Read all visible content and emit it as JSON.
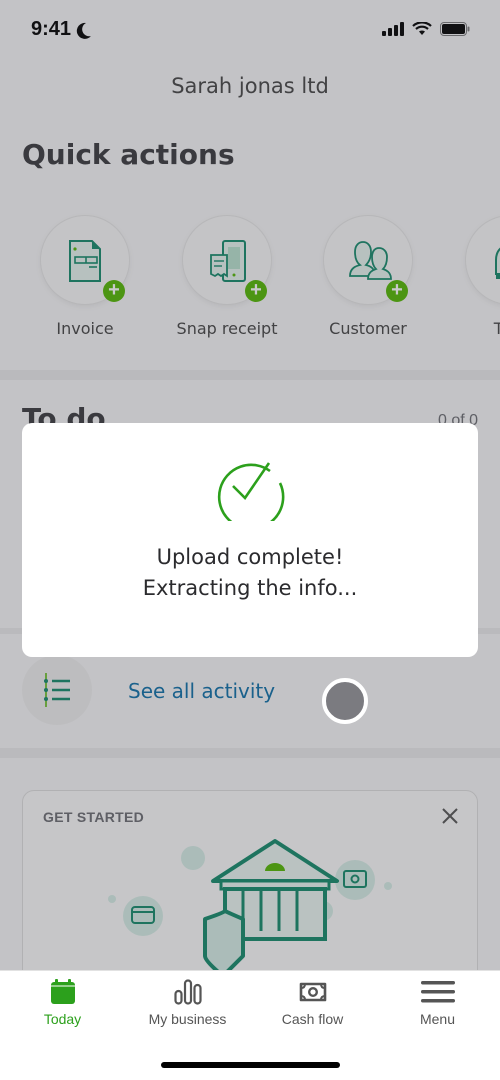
{
  "status_bar": {
    "time": "9:41",
    "focus_icon": "moon-icon",
    "icons": [
      "cellular-signal-icon",
      "wifi-icon",
      "battery-icon"
    ]
  },
  "header": {
    "company_name": "Sarah jonas ltd"
  },
  "quick_actions": {
    "title": "Quick actions",
    "items": [
      {
        "label": "Invoice",
        "icon": "invoice-icon"
      },
      {
        "label": "Snap receipt",
        "icon": "snap-receipt-icon"
      },
      {
        "label": "Customer",
        "icon": "customer-icon"
      },
      {
        "label": "Trac",
        "icon": "track-mileage-icon"
      }
    ]
  },
  "todo": {
    "title": "To do",
    "count": "0 of 0"
  },
  "activity": {
    "link_label": "See all activity",
    "icon": "activity-list-icon"
  },
  "get_started": {
    "label": "GET STARTED",
    "close_icon": "close-icon",
    "illustration": "bank-shield-illustration"
  },
  "modal": {
    "icon": "check-circle-icon",
    "line1": "Upload complete!",
    "line2": "Extracting the info..."
  },
  "tab_bar": {
    "tabs": [
      {
        "label": "Today",
        "icon": "calendar-icon",
        "active": true
      },
      {
        "label": "My business",
        "icon": "bar-chart-icon",
        "active": false
      },
      {
        "label": "Cash flow",
        "icon": "cash-icon",
        "active": false
      },
      {
        "label": "Menu",
        "icon": "hamburger-menu-icon",
        "active": false
      }
    ]
  },
  "colors": {
    "brand_green": "#2ca01c",
    "plus_green": "#53b700",
    "icon_teal": "#138a6a",
    "link_blue": "#0d6fa8"
  }
}
